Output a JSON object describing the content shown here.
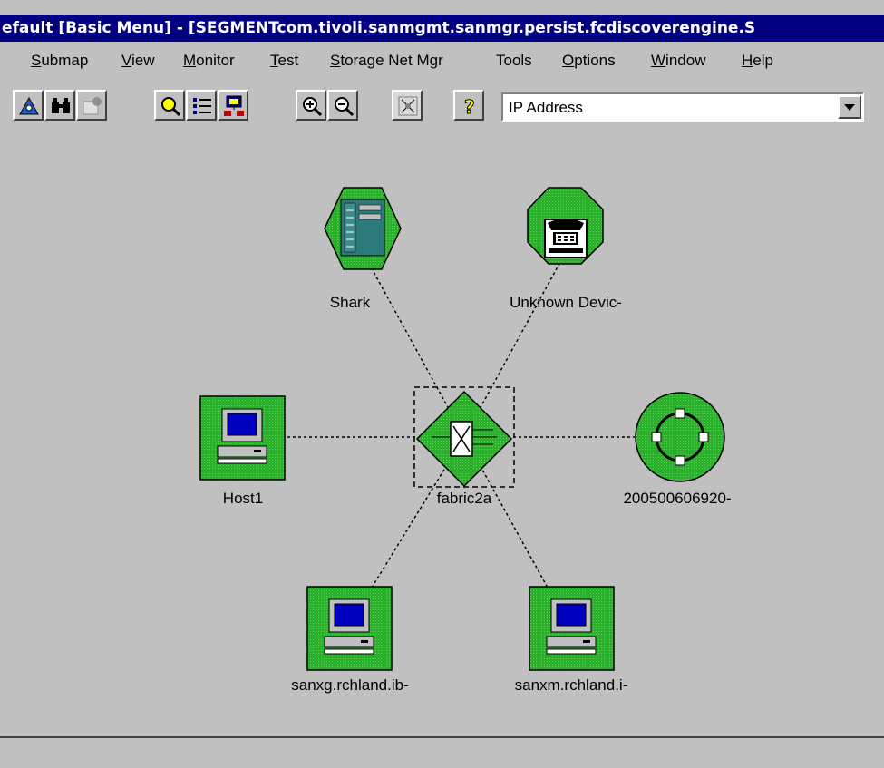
{
  "window": {
    "title": "efault [Basic Menu] - [SEGMENTcom.tivoli.sanmgmt.sanmgr.persist.fcdiscoverengine.S"
  },
  "menu": [
    {
      "label": "Submap",
      "mnemonic": "S",
      "rest": "ubmap"
    },
    {
      "label": "View",
      "mnemonic": "V",
      "rest": "iew"
    },
    {
      "label": "Monitor",
      "mnemonic": "M",
      "rest": "onitor"
    },
    {
      "label": "Test",
      "mnemonic": "T",
      "rest": "est"
    },
    {
      "label": "Storage Net Mgr",
      "mnemonic": "S",
      "rest": "torage Net Mgr"
    },
    {
      "label": "Tools",
      "mnemonic": "",
      "rest": "Tools"
    },
    {
      "label": "Options",
      "mnemonic": "O",
      "rest": "ptions"
    },
    {
      "label": "Window",
      "mnemonic": "W",
      "rest": "indow"
    },
    {
      "label": "Help",
      "mnemonic": "H",
      "rest": "elp"
    }
  ],
  "toolbar": {
    "buttons": [
      {
        "name": "home-map-button",
        "icon": "home-map-icon"
      },
      {
        "name": "find-button",
        "icon": "binoculars-icon"
      },
      {
        "name": "object-button",
        "icon": "object-icon-disabled"
      },
      {
        "name": "zoom-object-button",
        "icon": "magnifier-icon"
      },
      {
        "name": "list-button",
        "icon": "list-icon"
      },
      {
        "name": "network-button",
        "icon": "network-icon"
      },
      {
        "name": "zoom-in-button",
        "icon": "zoom-in-icon"
      },
      {
        "name": "zoom-out-button",
        "icon": "zoom-out-icon"
      },
      {
        "name": "fit-button",
        "icon": "fit-icon"
      },
      {
        "name": "help-button",
        "icon": "question-icon"
      }
    ],
    "label_type": "IP Address"
  },
  "map": {
    "colors": {
      "node_green": "#2ab02a",
      "selection": "#000000",
      "link": "#000000"
    },
    "nodes": {
      "shark": {
        "label": "Shark",
        "icon": "storage-server-icon"
      },
      "unknown": {
        "label": "Unknown Devic-",
        "icon": "telephone-icon"
      },
      "host1": {
        "label": "Host1",
        "icon": "computer-icon"
      },
      "fabric": {
        "label": "fabric2a",
        "icon": "switch-icon"
      },
      "hub": {
        "label": "200500606920-",
        "icon": "hub-ring-icon"
      },
      "sanxg": {
        "label": "sanxg.rchland.ib-",
        "icon": "computer-icon"
      },
      "sanxm": {
        "label": "sanxm.rchland.i-",
        "icon": "computer-icon"
      }
    }
  }
}
